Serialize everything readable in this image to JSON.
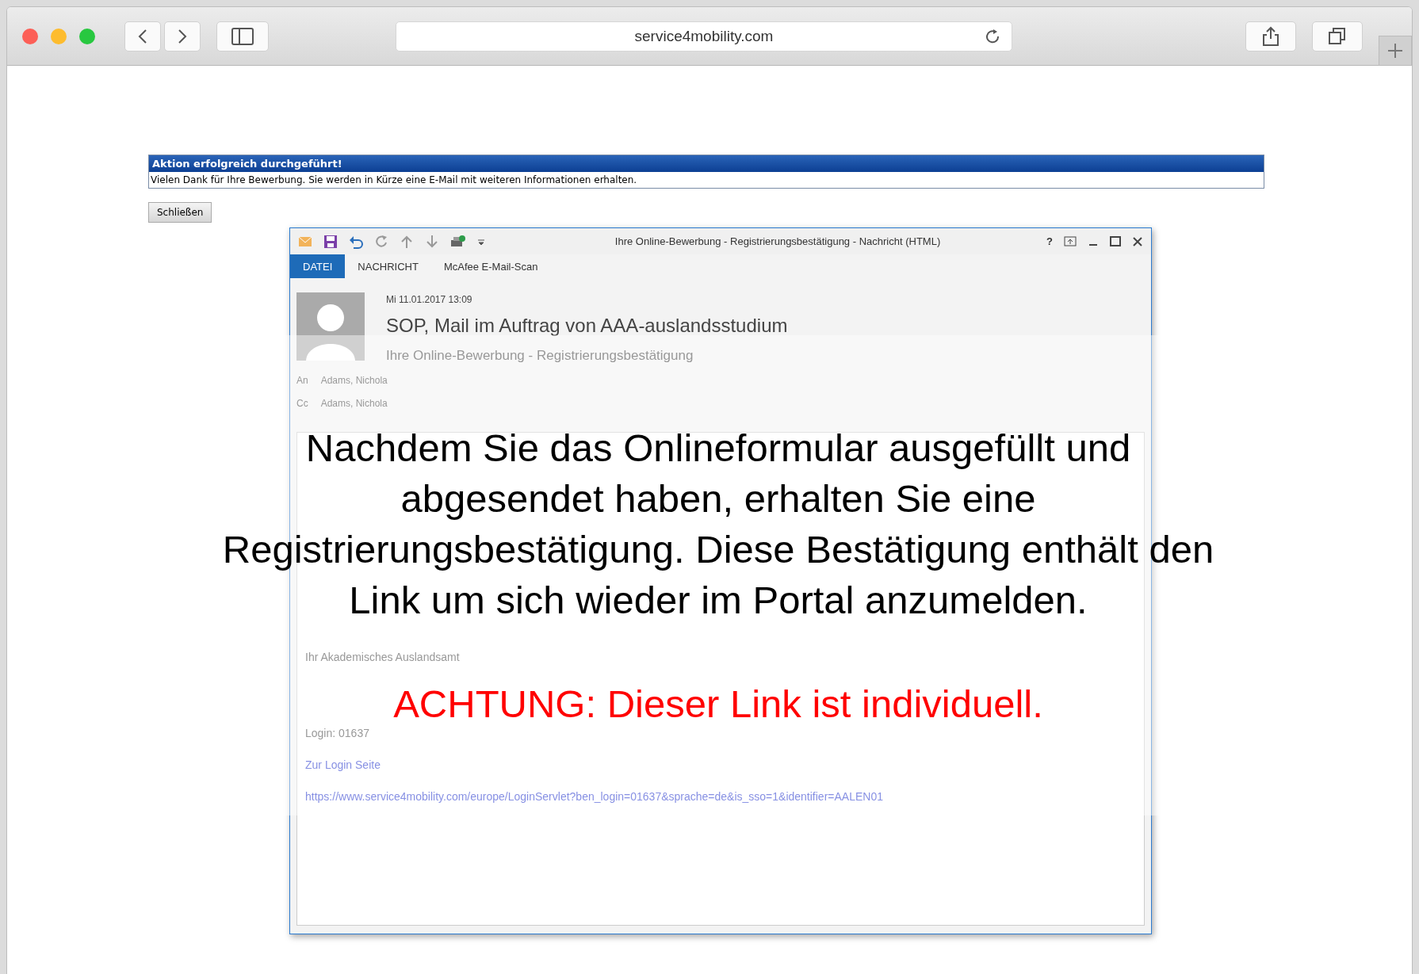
{
  "browser": {
    "url": "service4mobility.com"
  },
  "notice": {
    "title": "Aktion erfolgreich durchgeführt!",
    "message": "Vielen Dank für Ihre Bewerbung. Sie werden in Kürze eine E-Mail mit weiteren Informationen erhalten.",
    "close_button": "Schließen"
  },
  "email_window": {
    "title": "Ihre Online-Bewerbung -  Registrierungsbestätigung - Nachricht (HTML)",
    "help": "?",
    "tabs": [
      {
        "label": "DATEI",
        "selected": true
      },
      {
        "label": "NACHRICHT",
        "selected": false
      },
      {
        "label": "McAfee E-Mail-Scan",
        "selected": false
      }
    ],
    "date": "Mi 11.01.2017 13:09",
    "sender": "SOP, Mail im Auftrag von AAA-auslandsstudium",
    "subject": "Ihre Online-Bewerbung -  Registrierungsbestätigung",
    "recipients": [
      {
        "label": "An",
        "name": "Adams, Nichola"
      },
      {
        "label": "Cc",
        "name": "Adams, Nichola"
      }
    ],
    "body": {
      "signature": "Ihr Akademisches Auslandsamt",
      "login": "Login: 01637",
      "link_text": "Zur Login Seite",
      "link_url": "https://www.service4mobility.com/europe/LoginServlet?ben_login=01637&sprache=de&is_sso=1&identifier=AALEN01"
    }
  },
  "overlay": {
    "text": "Nachdem Sie das Onlineformular ausgefüllt und abgesendet haben, erhalten Sie eine Registrierungsbestätigung. Diese Bestätigung enthält den Link um sich wieder im Portal anzumelden.",
    "warning": "ACHTUNG: Dieser Link ist individuell."
  }
}
